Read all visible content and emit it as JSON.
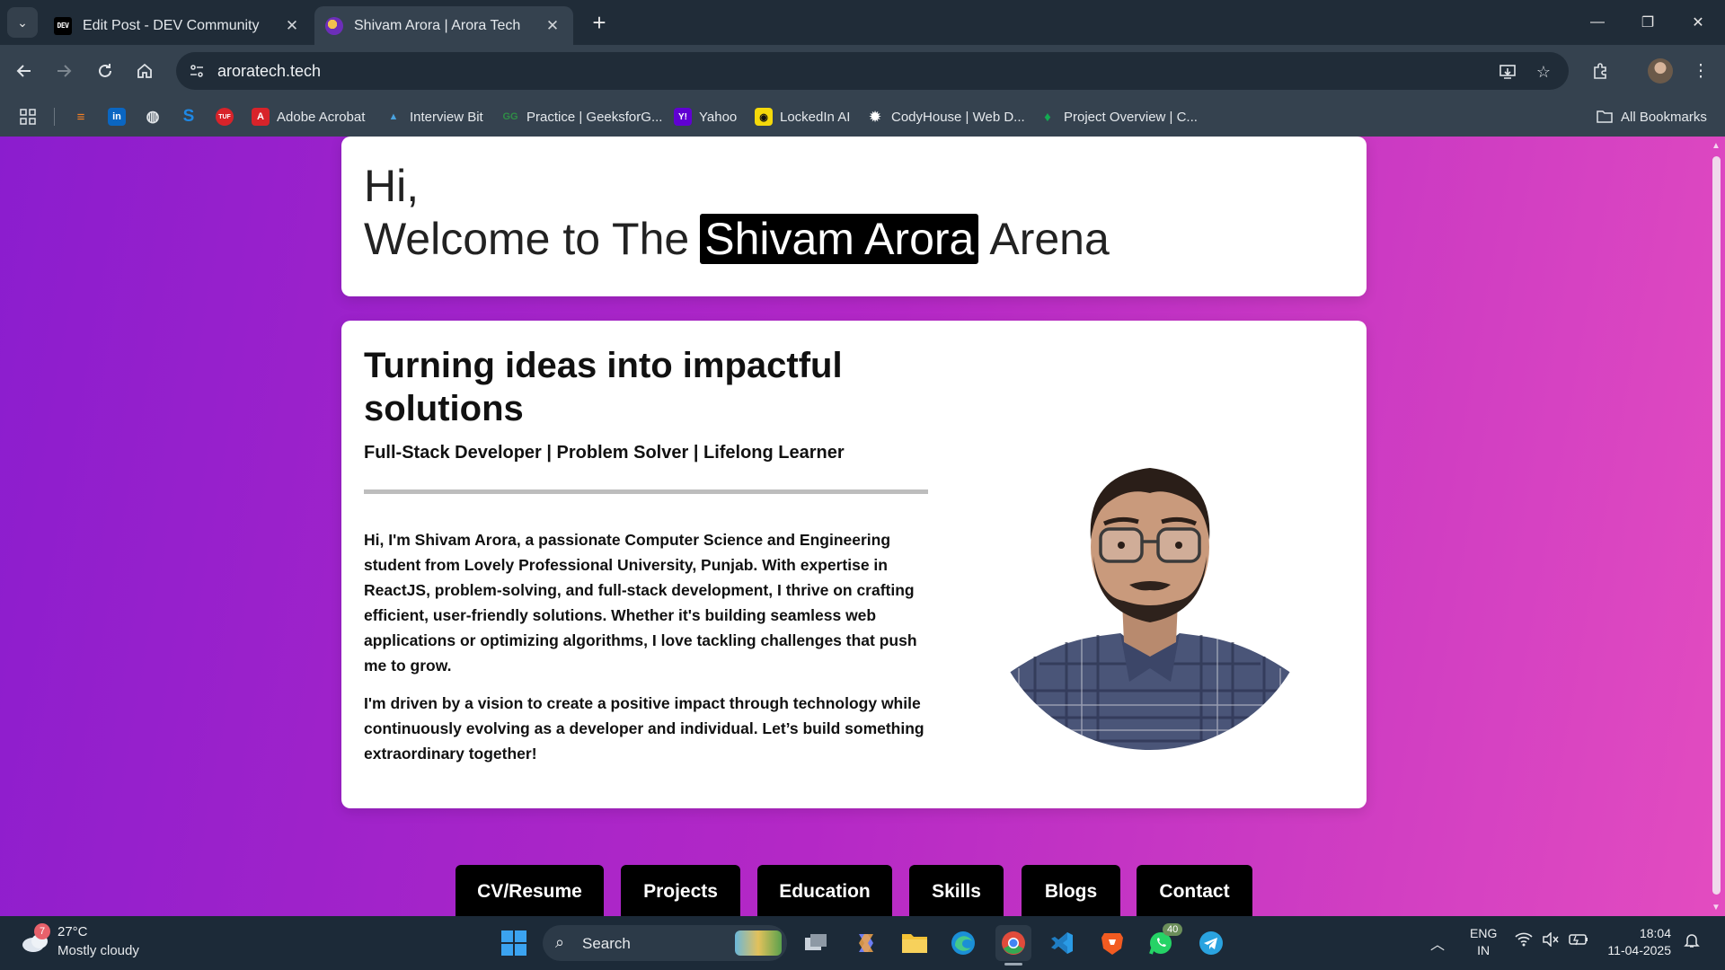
{
  "browser": {
    "tabs": [
      {
        "title": "Edit Post - DEV Community",
        "icon": "dev-logo-icon",
        "active": false
      },
      {
        "title": "Shivam Arora | Arora Tech",
        "icon": "arora-tech-icon",
        "active": true
      }
    ],
    "url": "aroratech.tech",
    "bookmarks": [
      {
        "label": "",
        "icon": "stackoverflow-icon",
        "color": "#f48024"
      },
      {
        "label": "",
        "icon": "linkedin-icon",
        "color": "#0a66c2"
      },
      {
        "label": "",
        "icon": "globe-icon",
        "color": "#dfe3e7"
      },
      {
        "label": "",
        "icon": "skype-icon",
        "color": "#1e88e5"
      },
      {
        "label": "",
        "icon": "tuf-icon",
        "color": "#d8232a"
      },
      {
        "label": "Adobe Acrobat",
        "icon": "acrobat-icon",
        "color": "#d8232a"
      },
      {
        "label": "Interview Bit",
        "icon": "interviewbit-icon",
        "color": "#4aa3df"
      },
      {
        "label": "Practice | GeeksforG...",
        "icon": "geeksforgeeks-icon",
        "color": "#2f8d46"
      },
      {
        "label": "Yahoo",
        "icon": "yahoo-icon",
        "color": "#6001d2"
      },
      {
        "label": "LockedIn AI",
        "icon": "lockedin-icon",
        "color": "#f5d90a"
      },
      {
        "label": "CodyHouse | Web D...",
        "icon": "codyhouse-icon",
        "color": "#ffffff"
      },
      {
        "label": "Project Overview | C...",
        "icon": "mongodb-leaf-icon",
        "color": "#13aa52"
      }
    ],
    "all_bookmarks": "All Bookmarks"
  },
  "page": {
    "hero": {
      "greeting": "Hi,",
      "welcome_prefix": "Welcome to The",
      "name": "Shivam Arora",
      "welcome_suffix": "Arena"
    },
    "about": {
      "title": "Turning ideas into impactful solutions",
      "subtitle": "Full-Stack Developer | Problem Solver | Lifelong Learner",
      "paragraph1": "Hi, I'm Shivam Arora, a passionate Computer Science and Engineering student from Lovely Professional University, Punjab. With expertise in ReactJS, problem-solving, and full-stack development, I thrive on crafting efficient, user-friendly solutions. Whether it's building seamless web applications or optimizing algorithms, I love tackling challenges that push me to grow.",
      "paragraph2": "I'm driven by a vision to create a positive impact through technology while continuously evolving as a developer and individual. Let’s build something extraordinary together!"
    },
    "nav_buttons": [
      "CV/Resume",
      "Projects",
      "Education",
      "Skills",
      "Blogs",
      "Contact"
    ]
  },
  "taskbar": {
    "weather": {
      "temp": "27°C",
      "desc": "Mostly cloudy",
      "badge": "7"
    },
    "search_placeholder": "Search",
    "whatsapp_badge": "40",
    "lang_line1": "ENG",
    "lang_line2": "IN",
    "time": "18:04",
    "date": "11-04-2025"
  },
  "colors": {
    "bg_gradient_start": "#8b1dce",
    "bg_gradient_end": "#e34cc0",
    "card": "#ffffff",
    "nav_button": "#000000"
  }
}
